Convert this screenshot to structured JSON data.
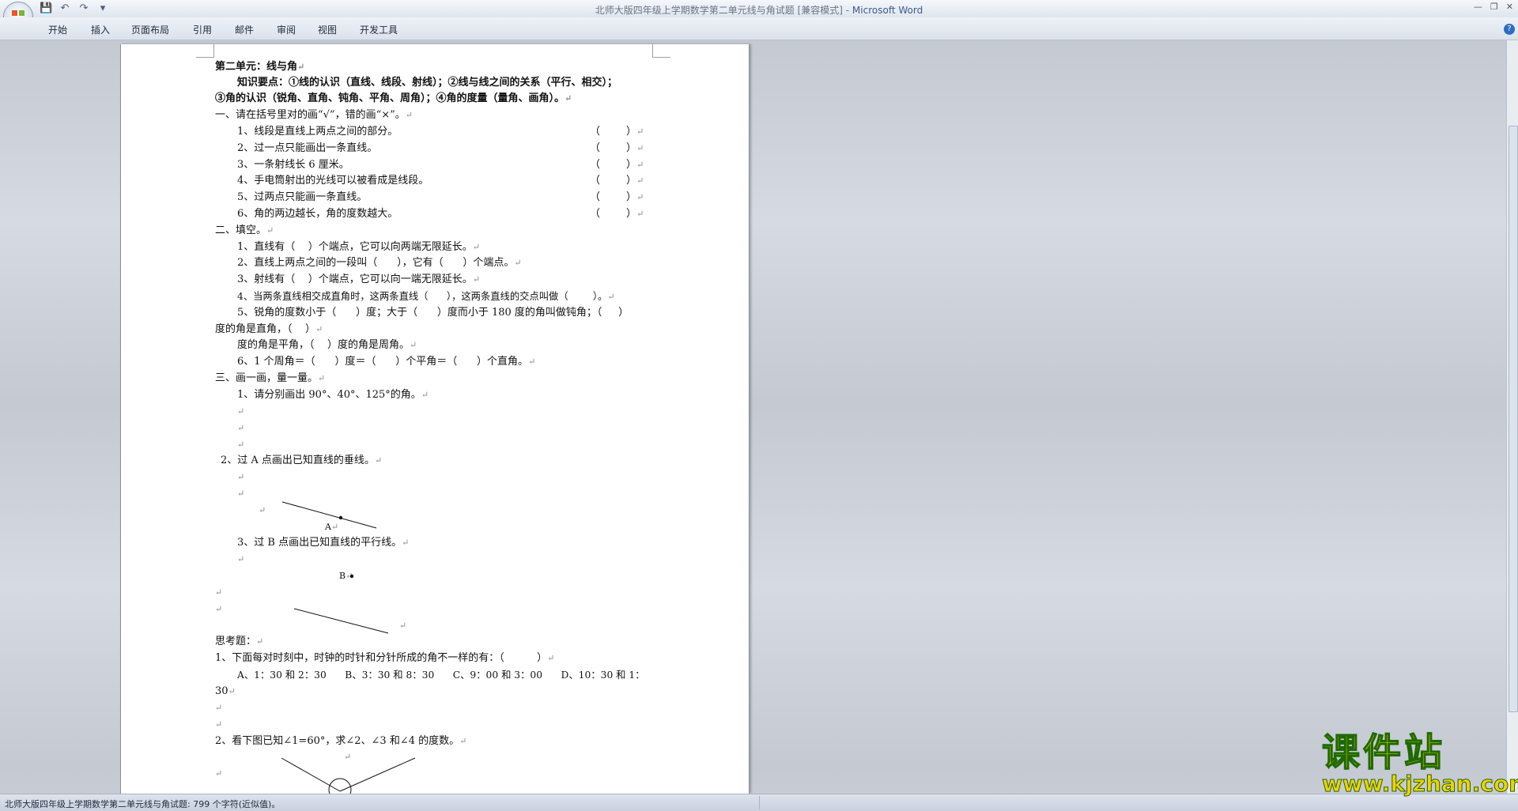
{
  "window": {
    "title_doc": "北师大版四年级上学期数学第二单元线与角试题 [兼容模式] - ",
    "title_app": "Microsoft Word"
  },
  "quick_access": {
    "save": "💾",
    "undo": "↶",
    "redo": "↷",
    "more": "▾"
  },
  "ribbon": {
    "tabs": [
      "开始",
      "插入",
      "页面布局",
      "引用",
      "邮件",
      "审阅",
      "视图",
      "开发工具"
    ]
  },
  "doc": {
    "lines": [
      "第二单元：线与角",
      "知识要点：①线的认识（直线、线段、射线）；②线与线之间的关系（平行、相交）；",
      "③角的认识（锐角、直角、钝角、平角、周角）；④角的度量（量角、画角）。",
      "一、请在括号里对的画“√”，错的画“×”。",
      "1、线段是直线上两点之间的部分。",
      "2、过一点只能画出一条直线。",
      "3、一条射线长 6 厘米。",
      "4、手电筒射出的光线可以被看成是线段。",
      "5、过两点只能画一条直线。",
      "6、角的两边越长，角的度数越大。",
      "二、填空。",
      "1、直线有（    ）个端点，它可以向两端无限延长。",
      "2、直线上两点之间的一段叫（      ），它有（      ）个端点。",
      "3、射线有（    ）个端点，它可以向一端无限延长。",
      "4、当两条直线相交成直角时，这两条直线（      ），这两条直线的交点叫做（        ）。",
      "5、锐角的度数小于（      ）度；大于（      ）度而小于 180 度的角叫做钝角；（     ）",
      "度的角是直角，（    ）",
      "度的角是平角，（    ）度的角是周角。",
      "6、1 个周角＝（      ）度＝（      ）个平角＝（      ）个直角。",
      "三、画一画，量一量。",
      "1、请分别画出 90°、40°、125°的角。",
      "2、过 A 点画出已知直线的垂线。",
      "A",
      "3、过 B 点画出已知直线的平行线。",
      "B",
      "思考题：",
      "1、下面每对时刻中，时钟的时针和分针所成的角不一样的有：（          ）",
      "A、1：30 和 2：30      B、3：30 和 8：30      C、9：00 和 3：00      D、10：30 和 1：",
      "30",
      "2、看下图已知∠1=60°，求∠2、∠3 和∠4 的度数。"
    ],
    "paren": "（        ）",
    "para_mark": "↵"
  },
  "status": {
    "text": "北师大版四年级上学期数学第二单元线与角试题: 799 个字符(近似值)。"
  },
  "watermark": {
    "cn": "课件站",
    "url": "www.kjzhan.com"
  }
}
